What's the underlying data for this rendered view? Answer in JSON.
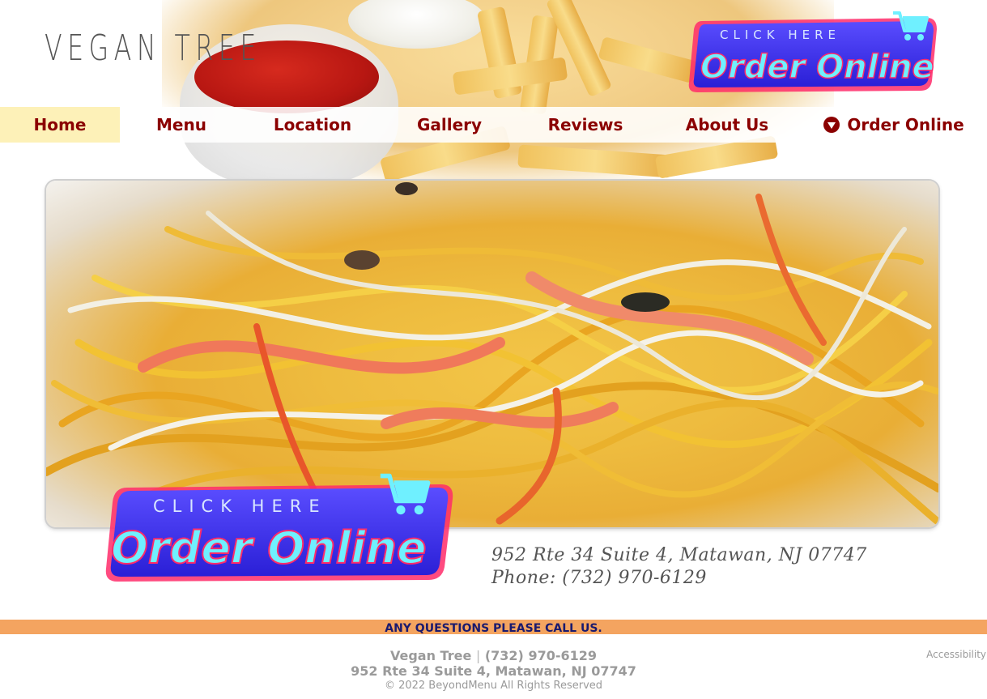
{
  "brand": {
    "logo_text": "VEGAN TREE"
  },
  "order_badge": {
    "small_text": "CLICK HERE",
    "big_text": "Order Online"
  },
  "nav": {
    "items": [
      {
        "label": "Home",
        "active": true
      },
      {
        "label": "Menu"
      },
      {
        "label": "Location"
      },
      {
        "label": "Gallery"
      },
      {
        "label": "Reviews"
      },
      {
        "label": "About Us"
      },
      {
        "label": "Order Online",
        "icon": "order-icon"
      }
    ]
  },
  "location": {
    "address": "952 Rte 34 Suite 4, Matawan, NJ 07747",
    "phone_line": "Phone: (732) 970-6129"
  },
  "footer": {
    "banner": "ANY QUESTIONS PLEASE CALL US.",
    "name": "Vegan Tree",
    "separator": "|",
    "phone": "(732) 970-6129",
    "address": "952 Rte 34 Suite 4, Matawan, NJ 07747",
    "copyright": "© 2022 BeyondMenu All Rights Reserved",
    "accessibility": "Accessibility"
  },
  "colors": {
    "nav_text": "#8b0000",
    "nav_active_bg": "#fdf1b8",
    "footer_strip": "#f4a460",
    "footer_banner_text": "#1a1a6e",
    "badge_blue": "#3b2ee8",
    "badge_text": "#6ff0ff"
  }
}
